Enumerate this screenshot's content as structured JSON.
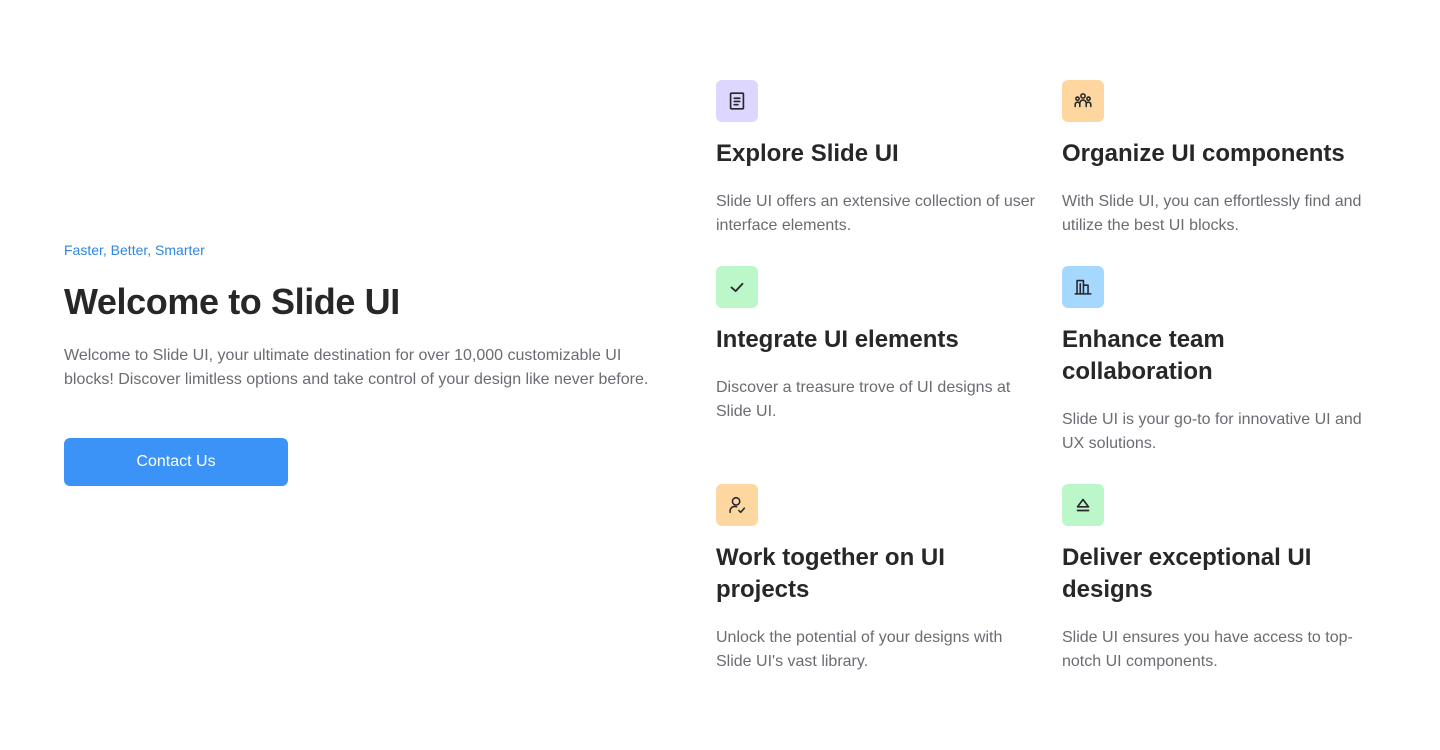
{
  "hero": {
    "eyebrow": "Faster, Better, Smarter",
    "title": "Welcome to Slide UI",
    "description": "Welcome to Slide UI, your ultimate destination for over 10,000 customizable UI blocks! Discover limitless options and take control of your design like never before.",
    "button_label": "Contact Us"
  },
  "features": [
    {
      "title": "Explore Slide UI",
      "description": "Slide UI offers an extensive collection of user interface elements.",
      "icon": "document-icon",
      "icon_bg": "#ddd6fe"
    },
    {
      "title": "Organize UI components",
      "description": "With Slide UI, you can effortlessly find and utilize the best UI blocks.",
      "icon": "team-icon",
      "icon_bg": "#fed7a0"
    },
    {
      "title": "Integrate UI elements",
      "description": "Discover a treasure trove of UI designs at Slide UI.",
      "icon": "check-icon",
      "icon_bg": "#bbf7c8"
    },
    {
      "title": "Enhance team collaboration",
      "description": "Slide UI is your go-to for innovative UI and UX solutions.",
      "icon": "building-icon",
      "icon_bg": "#a5d8ff"
    },
    {
      "title": "Work together on UI projects",
      "description": "Unlock the potential of your designs with Slide UI's vast library.",
      "icon": "user-check-icon",
      "icon_bg": "#fed7a0"
    },
    {
      "title": "Deliver exceptional UI designs",
      "description": "Slide UI ensures you have access to top-notch UI components.",
      "icon": "eject-icon",
      "icon_bg": "#bbf7c8"
    }
  ],
  "colors": {
    "accent": "#3b93f7",
    "eyebrow": "#2f86e0"
  }
}
